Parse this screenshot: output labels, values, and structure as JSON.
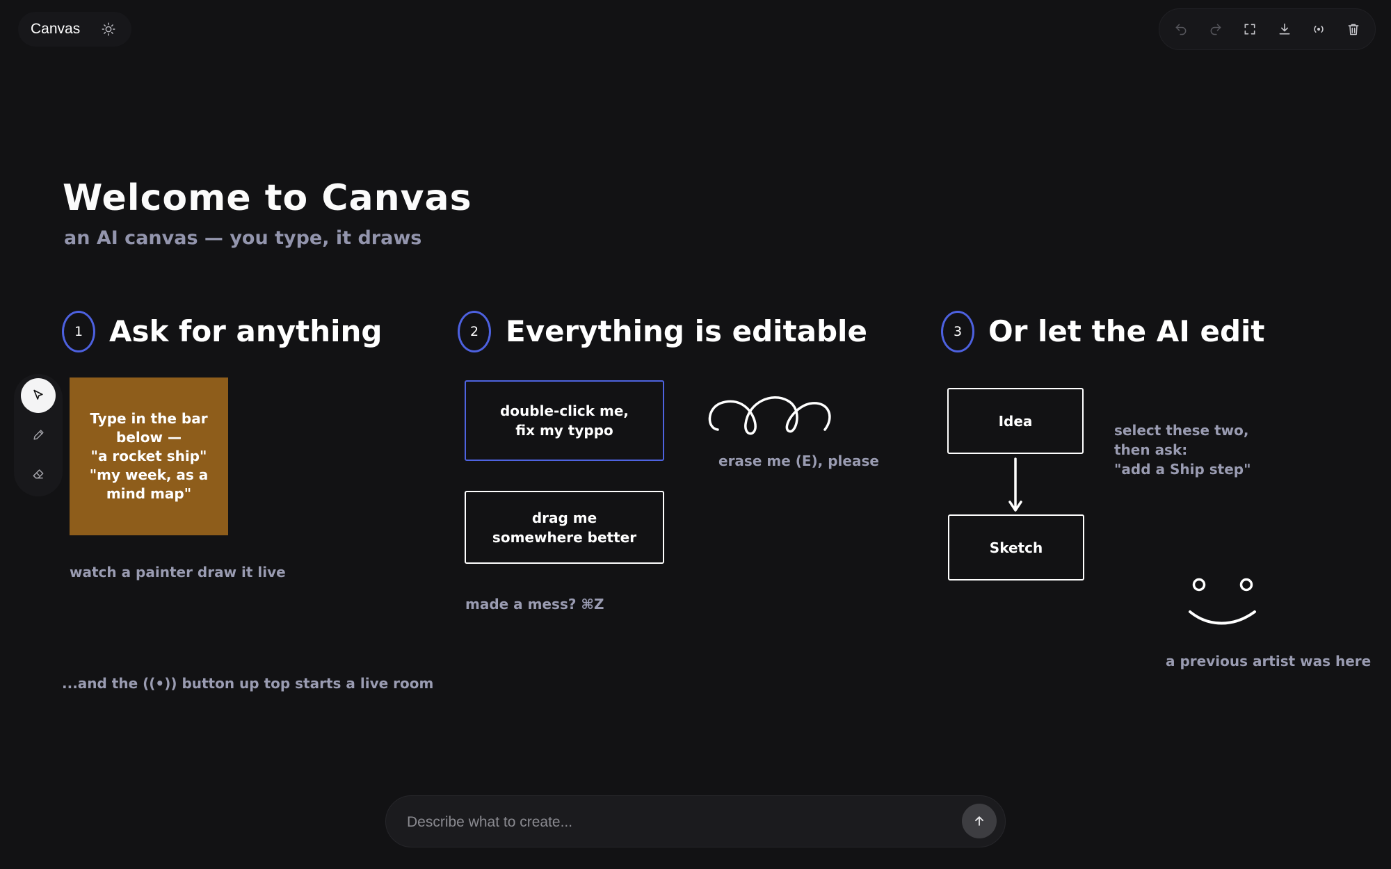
{
  "app": {
    "title": "Canvas"
  },
  "header": {
    "theme_icon": "sun-icon"
  },
  "toolbar": {
    "icons": [
      "undo-icon",
      "redo-icon",
      "fullscreen-icon",
      "download-icon",
      "live-room-icon",
      "trash-icon"
    ]
  },
  "tools": {
    "items": [
      {
        "icon": "select-cursor-icon",
        "active": true
      },
      {
        "icon": "pencil-icon",
        "active": false
      },
      {
        "icon": "eraser-icon",
        "active": false
      }
    ]
  },
  "canvas": {
    "title": "Welcome to Canvas",
    "subtitle": "an AI canvas — you type, it draws",
    "steps": [
      {
        "number": "1",
        "heading": "Ask for anything"
      },
      {
        "number": "2",
        "heading": "Everything is editable"
      },
      {
        "number": "3",
        "heading": "Or let the AI edit"
      }
    ],
    "sticky_note": "Type in the bar\nbelow —\n\"a rocket ship\"\n\"my week, as a\nmind map\"",
    "painter_caption": "watch a painter draw it live",
    "live_room_caption": "...and the ((•)) button up top starts a live room",
    "edit_box_1": "double-click me,\nfix my typpo",
    "edit_box_2": "drag me\nsomewhere better",
    "undo_caption": "made a mess? ⌘Z",
    "erase_caption": "erase me (E), please",
    "flow": {
      "node_1": "Idea",
      "node_2": "Sketch"
    },
    "ai_instruction": "select these two,\nthen ask:\n\"add a Ship step\"",
    "artist_caption": "a previous artist was here"
  },
  "prompt": {
    "placeholder": "Describe what to create...",
    "send_icon": "arrow-up-icon"
  },
  "colors": {
    "background": "#121214",
    "accent": "#4d61e0",
    "sticky_note": "#8e5d1b",
    "muted_text": "#9a9cb2"
  }
}
